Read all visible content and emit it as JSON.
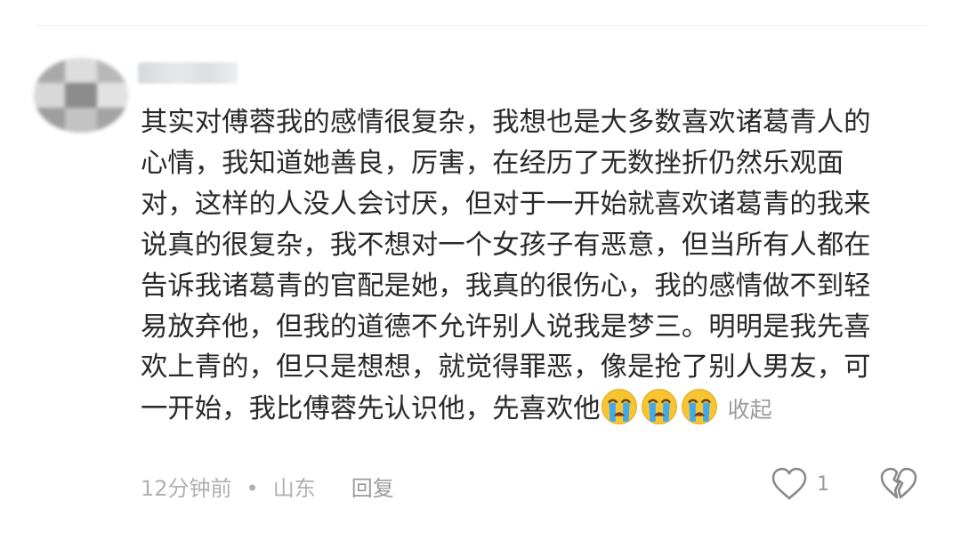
{
  "comment": {
    "lines": [
      "其实对傅蓉我的感情很复杂，我想也是大多数喜欢诸葛青人的",
      "心情，我知道她善良，厉害，在经历了无数挫折仍然乐观面",
      "对，这样的人没人会讨厌，但对于一开始就喜欢诸葛青的我来",
      "说真的很复杂，我不想对一个女孩子有恶意，但当所有人都在",
      "告诉我诸葛青的官配是她，我真的很伤心，我的感情做不到轻",
      "易放弃他，但我的道德不允许别人说我是梦三。明明是我先喜",
      "欢上青的，但只是想想，就觉得罪恶，像是抢了别人男友，可",
      "一开始，我比傅蓉先认识他，先喜欢他"
    ],
    "emojis": [
      "loudly-crying-face",
      "loudly-crying-face",
      "loudly-crying-face"
    ],
    "collapse_label": "收起"
  },
  "meta": {
    "time": "12分钟前",
    "separator": "•",
    "location": "山东",
    "reply_label": "回复"
  },
  "actions": {
    "like_icon": "heart-outline-icon",
    "like_count": "1",
    "dislike_icon": "broken-heart-icon"
  },
  "colors": {
    "text": "#2a2a2a",
    "meta": "#b0b0b0",
    "icon": "#8a8a8a",
    "emoji_face": "#f7c531",
    "emoji_tears": "#3fa9ee"
  }
}
